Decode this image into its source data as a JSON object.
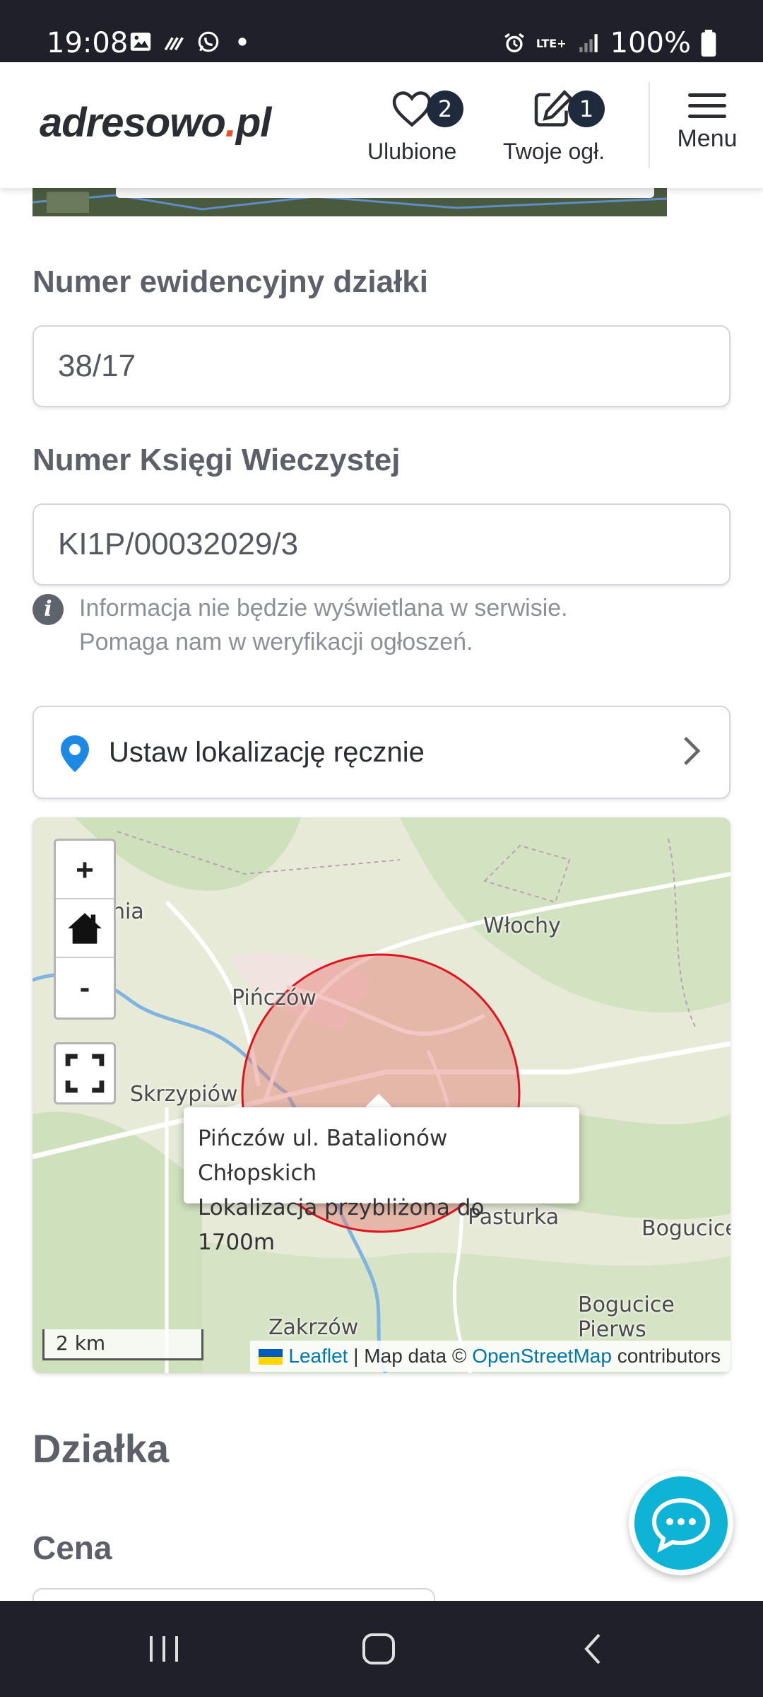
{
  "status_bar": {
    "time": "19:08",
    "network": "LTE+",
    "battery": "100%",
    "icons_left": [
      "image-icon",
      "signal-wave-icon",
      "whatsapp-icon",
      "dot-icon"
    ],
    "icons_right": [
      "alarm-icon",
      "lte-icon",
      "signal-bars-icon",
      "battery-icon"
    ]
  },
  "header": {
    "logo_main": "adresowo",
    "logo_dot": ".",
    "logo_tld": "pl",
    "favorites": {
      "label": "Ulubione",
      "count": "2"
    },
    "my_ads": {
      "label": "Twoje ogł.",
      "count": "1"
    },
    "menu": {
      "label": "Menu"
    }
  },
  "form": {
    "parcel_number": {
      "label": "Numer ewidencyjny działki",
      "value": "38/17"
    },
    "land_register": {
      "label": "Numer Księgi Wieczystej",
      "value": "KI1P/00032029/3"
    },
    "info": {
      "line1": "Informacja nie będzie wyświetlana w serwisie.",
      "line2": "Pomaga nam w weryfikacji ogłoszeń."
    },
    "set_location": {
      "label": "Ustaw lokalizację ręcznie"
    }
  },
  "map": {
    "zoom_in": "+",
    "zoom_out": "-",
    "place_labels": {
      "wlochy": "Włochy",
      "pinczow": "Pińczów",
      "skrzypiow": "Skrzypiów",
      "pasturka": "Pasturka",
      "bogucice": "Bogucice",
      "bogucice_p": "Bogucice Pierws",
      "zakrzow": "Zakrzów",
      "nia": "nia"
    },
    "popup": {
      "line1": "Pińczów ul. Batalionów Chłopskich",
      "line2": "Lokalizacja przybliżona do 1700m"
    },
    "scale": "2 km",
    "attribution": {
      "leaflet": "Leaflet",
      "separator": "| Map data ©",
      "osm": "OpenStreetMap",
      "contributors": "contributors"
    },
    "colors": {
      "circle_stroke": "#e0141e",
      "circle_fill": "#e57a72",
      "water": "#7fb4e0"
    }
  },
  "section": {
    "title": "Działka",
    "price_label": "Cena"
  },
  "colors": {
    "accent": "#0fb3d6",
    "pin": "#1e88e5",
    "dark": "#1f2029"
  }
}
